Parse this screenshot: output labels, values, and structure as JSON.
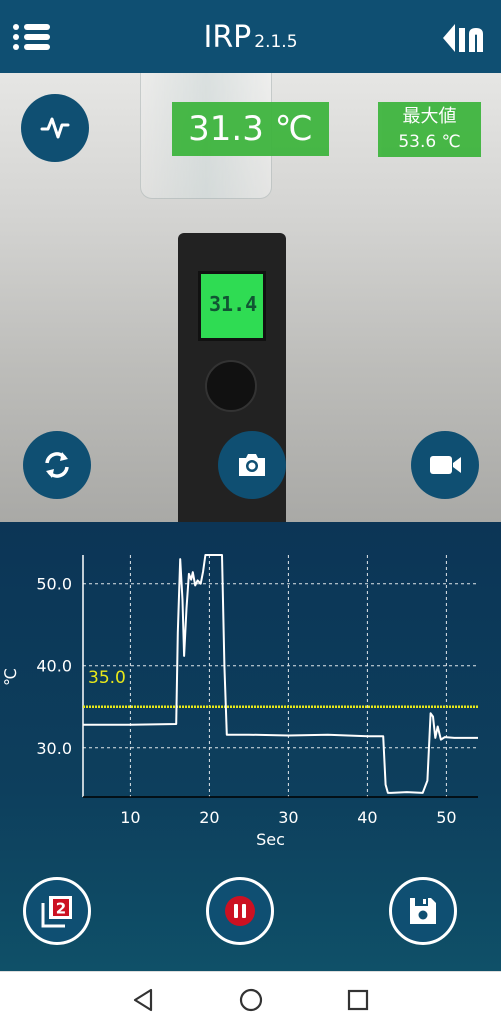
{
  "app": {
    "name": "IRP",
    "version": "2.1.5"
  },
  "icons": {
    "menu": "menu-list-icon",
    "logo": "brand-logo-icon",
    "wave": "waveform-icon",
    "refresh": "refresh-icon",
    "camera": "camera-icon",
    "video": "video-camera-icon",
    "count": "copy-layers-icon",
    "pause": "pause-icon",
    "save": "floppy-disk-icon"
  },
  "readout": {
    "current": "31.3 ℃",
    "max_label": "最大値",
    "max_value": "53.6 ℃"
  },
  "device_display": "31.4",
  "snapshot_count": "2",
  "colors": {
    "primary": "#0f4f72",
    "readout_bg": "#3fb53f",
    "threshold": "#e8e81a",
    "badge": "#cc1122"
  },
  "chart_data": {
    "type": "line",
    "xlabel": "Sec",
    "ylabel": "℃",
    "xlim": [
      4,
      54
    ],
    "ylim": [
      24,
      53.5
    ],
    "x_ticks": [
      10,
      20,
      30,
      40,
      50
    ],
    "y_ticks": [
      30.0,
      40.0,
      50.0
    ],
    "x_tick_labels": [
      "10",
      "20",
      "30",
      "40",
      "50"
    ],
    "y_tick_labels": [
      "30.0",
      "40.0",
      "50.0"
    ],
    "grid": true,
    "threshold": {
      "value": 35.0,
      "label": "35.0"
    },
    "series": [
      {
        "x": [
          4,
          10,
          15.8,
          16.0,
          16.3,
          16.6,
          16.8,
          17.1,
          17.4,
          17.7,
          17.9,
          18.2,
          18.5,
          18.9,
          19.2,
          19.5,
          20.0,
          20.5,
          21.0,
          21.6,
          21.9,
          22.2,
          25,
          30,
          35,
          40,
          42.0,
          42.3,
          42.6,
          43,
          45,
          47.0,
          47.6,
          48.0,
          48.3,
          48.6,
          48.9,
          49.3,
          49.8,
          51,
          54
        ],
        "y": [
          32.8,
          32.8,
          32.9,
          44,
          53.0,
          48,
          41.2,
          47,
          51.2,
          50.5,
          51.4,
          49.8,
          50.4,
          50.0,
          51.5,
          53.5,
          53.5,
          53.5,
          53.5,
          53.5,
          40,
          31.6,
          31.6,
          31.5,
          31.6,
          31.4,
          31.4,
          25.5,
          24.5,
          24.5,
          24.6,
          24.5,
          26,
          34.2,
          33.8,
          31.2,
          32.6,
          31.0,
          31.3,
          31.2,
          31.2
        ]
      }
    ]
  }
}
